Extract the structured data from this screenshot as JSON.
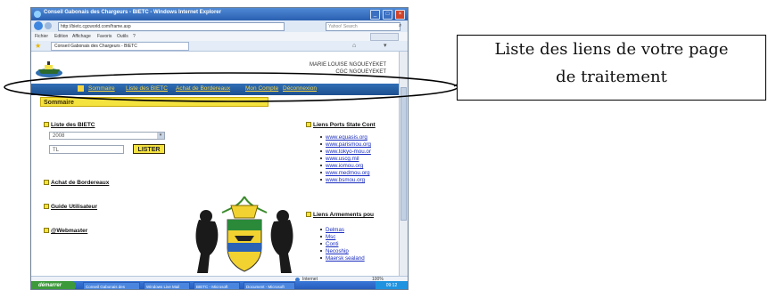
{
  "window": {
    "title": "Conseil Gabonais des Chargeurs - BIETC - Windows Internet Explorer",
    "address": "http://bietc.cgcworld.com/frame.asp",
    "search_placeholder": "Yahoo! Search",
    "tab_label": "Conseil Gabonais des Chargeurs - BIETC",
    "menu": [
      "Fichier",
      "Edition",
      "Affichage",
      "Favoris",
      "Outils",
      "?"
    ]
  },
  "header": {
    "user_name": "MARIE LOUISE NGOUEYEKET",
    "user_code": "CGC NGOUEYEKET"
  },
  "nav": {
    "items": [
      "Sommaire",
      "Liste des BIETC",
      "Achat de Bordereaux",
      "Mon Compte",
      "Déconnexion"
    ]
  },
  "content": {
    "sommaire_title": "Sommaire",
    "liste_title": "Liste des BIETC",
    "year_value": "2008",
    "search_value": "TL",
    "lister_button": "LISTER",
    "achat_link": "Achat de Bordereaux",
    "guide_link": "Guide Utilisateur",
    "webmaster_link": "@Webmaster"
  },
  "right": {
    "ports_title": "Liens Ports State Cont",
    "ports_links": [
      "www.equasis.org",
      "www.parismou.org",
      "www.tokyo-mou.or",
      "www.uscg.mil",
      "www.iomou.org",
      "www.medmou.org",
      "www.bsmou.org"
    ],
    "armements_title": "Liens Armements pou",
    "armements_links": [
      "Delmas",
      "Msc",
      "Conti",
      "Necoship",
      "Maersk sealand"
    ]
  },
  "statusbar": {
    "zone": "Internet",
    "zoom": "100%"
  },
  "taskbar": {
    "start": "démarrer",
    "items": [
      "Conseil Gabonais des",
      "Windows Live Mail",
      "BIETC - Microsoft",
      "Document - Microsoft"
    ],
    "clock": "09:12"
  },
  "callout": {
    "line1": "Liste des liens de votre page",
    "line2": "de traitement"
  },
  "colors": {
    "nav_bar": "#1d4f8e",
    "nav_link": "#f5d442",
    "sommaire_bg": "#f4e23f",
    "link": "#1a2dbf"
  }
}
